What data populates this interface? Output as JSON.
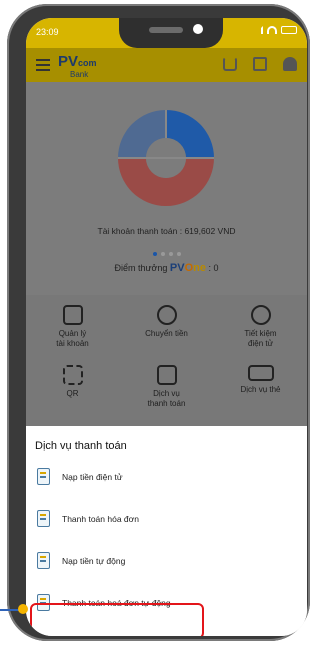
{
  "status_bar": {
    "time": "23:09"
  },
  "header": {
    "logo_text_1": "PV",
    "logo_text_2": "com",
    "logo_text_3": "Bank"
  },
  "account": {
    "balance_label": "Tài khoản thanh toán : 619,602 VND",
    "points_label": "Điểm thưởng",
    "points_brand_1": "PV",
    "points_brand_2": "O",
    "points_brand_3": "ne",
    "points_value": ": 0"
  },
  "services_grid": [
    {
      "label": "Quản lý\ntài khoản",
      "icon": "wallet-icon"
    },
    {
      "label": "Chuyển tiền",
      "icon": "transfer-icon"
    },
    {
      "label": "Tiết kiệm\nđiện tử",
      "icon": "piggy-bank-icon"
    },
    {
      "label": "QR",
      "icon": "qr-icon"
    },
    {
      "label": "Dịch vụ\nthanh toán",
      "icon": "payment-service-icon"
    },
    {
      "label": "Dịch vụ thẻ",
      "icon": "card-icon"
    }
  ],
  "sheet": {
    "title": "Dịch vụ thanh toán",
    "items": [
      {
        "label": "Nạp tiền điện tử",
        "icon": "phone-topup-icon"
      },
      {
        "label": "Thanh toán hóa đơn",
        "icon": "bill-icon"
      },
      {
        "label": "Nạp tiền tự động",
        "icon": "auto-topup-icon"
      },
      {
        "label": "Thanh toán hoá đơn tự động",
        "icon": "auto-bill-icon"
      }
    ]
  },
  "colors": {
    "brand_yellow": "#d7b500",
    "highlight_red": "#e3151a",
    "donut_blue": "#1f5aa8",
    "donut_red": "#b84a45"
  }
}
